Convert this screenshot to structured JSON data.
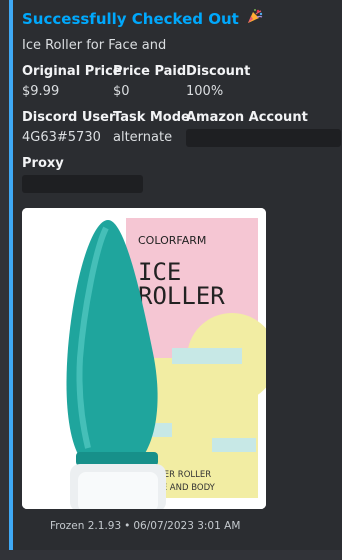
{
  "embed": {
    "title": "Successfully Checked Out",
    "title_emoji": "party-popper-icon",
    "description": "Ice Roller for Face and",
    "accent_color": "#3fa9f5",
    "title_color": "#00a8fc"
  },
  "fields": [
    {
      "name": "Original Price",
      "value": "$9.99"
    },
    {
      "name": "Price Paid",
      "value": "$0"
    },
    {
      "name": "Discount",
      "value": "100%"
    },
    {
      "name": "Discord User",
      "value": "4G63#5730"
    },
    {
      "name": "Task Mode",
      "value": "alternate"
    },
    {
      "name": "Amazon Account",
      "value": ""
    },
    {
      "name": "Proxy",
      "value": ""
    }
  ],
  "product_image": {
    "brand": "COLORFARM",
    "headline_1": "ICE",
    "headline_2": "ROLLER",
    "sub_1": "SAGER ROLLER",
    "sub_2": "FACE AND BODY"
  },
  "footer": {
    "app": "Frozen 2.1.93",
    "separator": "•",
    "timestamp": "06/07/2023 3:01 AM"
  }
}
